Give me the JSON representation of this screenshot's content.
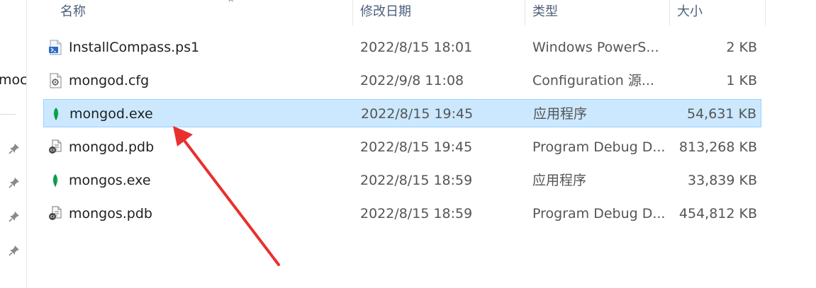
{
  "nav": {
    "partial_label": "moc"
  },
  "columns": {
    "name": "名称",
    "date": "修改日期",
    "type": "类型",
    "size": "大小"
  },
  "files": [
    {
      "name": "InstallCompass.ps1",
      "date": "2022/8/15 18:01",
      "type": "Windows PowerS...",
      "size": "2 KB",
      "icon": "powershell-script-icon"
    },
    {
      "name": "mongod.cfg",
      "date": "2022/9/8 11:08",
      "type": "Configuration 源...",
      "size": "1 KB",
      "icon": "config-file-icon"
    },
    {
      "name": "mongod.exe",
      "date": "2022/8/15 19:45",
      "type": "应用程序",
      "size": "54,631 KB",
      "icon": "mongodb-leaf-icon",
      "selected": true
    },
    {
      "name": "mongod.pdb",
      "date": "2022/8/15 19:45",
      "type": "Program Debug D...",
      "size": "813,268 KB",
      "icon": "debug-file-icon"
    },
    {
      "name": "mongos.exe",
      "date": "2022/8/15 18:59",
      "type": "应用程序",
      "size": "33,839 KB",
      "icon": "mongodb-leaf-icon"
    },
    {
      "name": "mongos.pdb",
      "date": "2022/8/15 18:59",
      "type": "Program Debug D...",
      "size": "454,812 KB",
      "icon": "debug-file-icon"
    }
  ],
  "colors": {
    "selection_bg": "#cce8ff",
    "selection_border": "#99d1ff",
    "annotation_arrow": "#e8302f",
    "mongodb_green": "#13aa52"
  }
}
